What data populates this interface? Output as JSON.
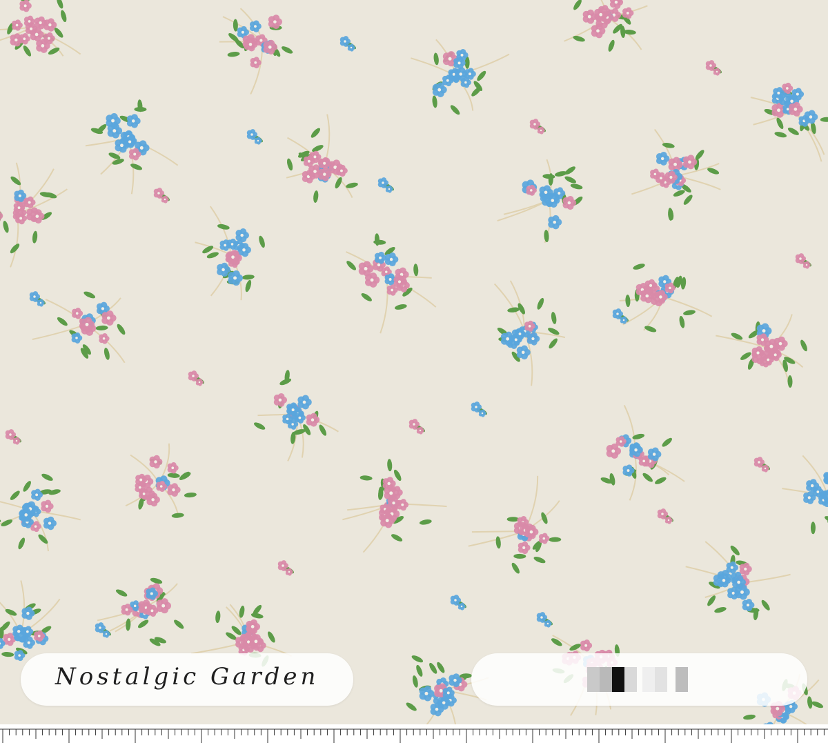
{
  "pattern_name": "Nostalgic Garden",
  "background_color": "#ebe7dc",
  "flower_colors": {
    "blue": "#5aa6dc",
    "pink": "#d98aa8",
    "leaf": "#5c9c48",
    "vine": "#e0d2b0"
  },
  "code_label": "pixelated-redacted",
  "ruler": "measurement-ruler"
}
